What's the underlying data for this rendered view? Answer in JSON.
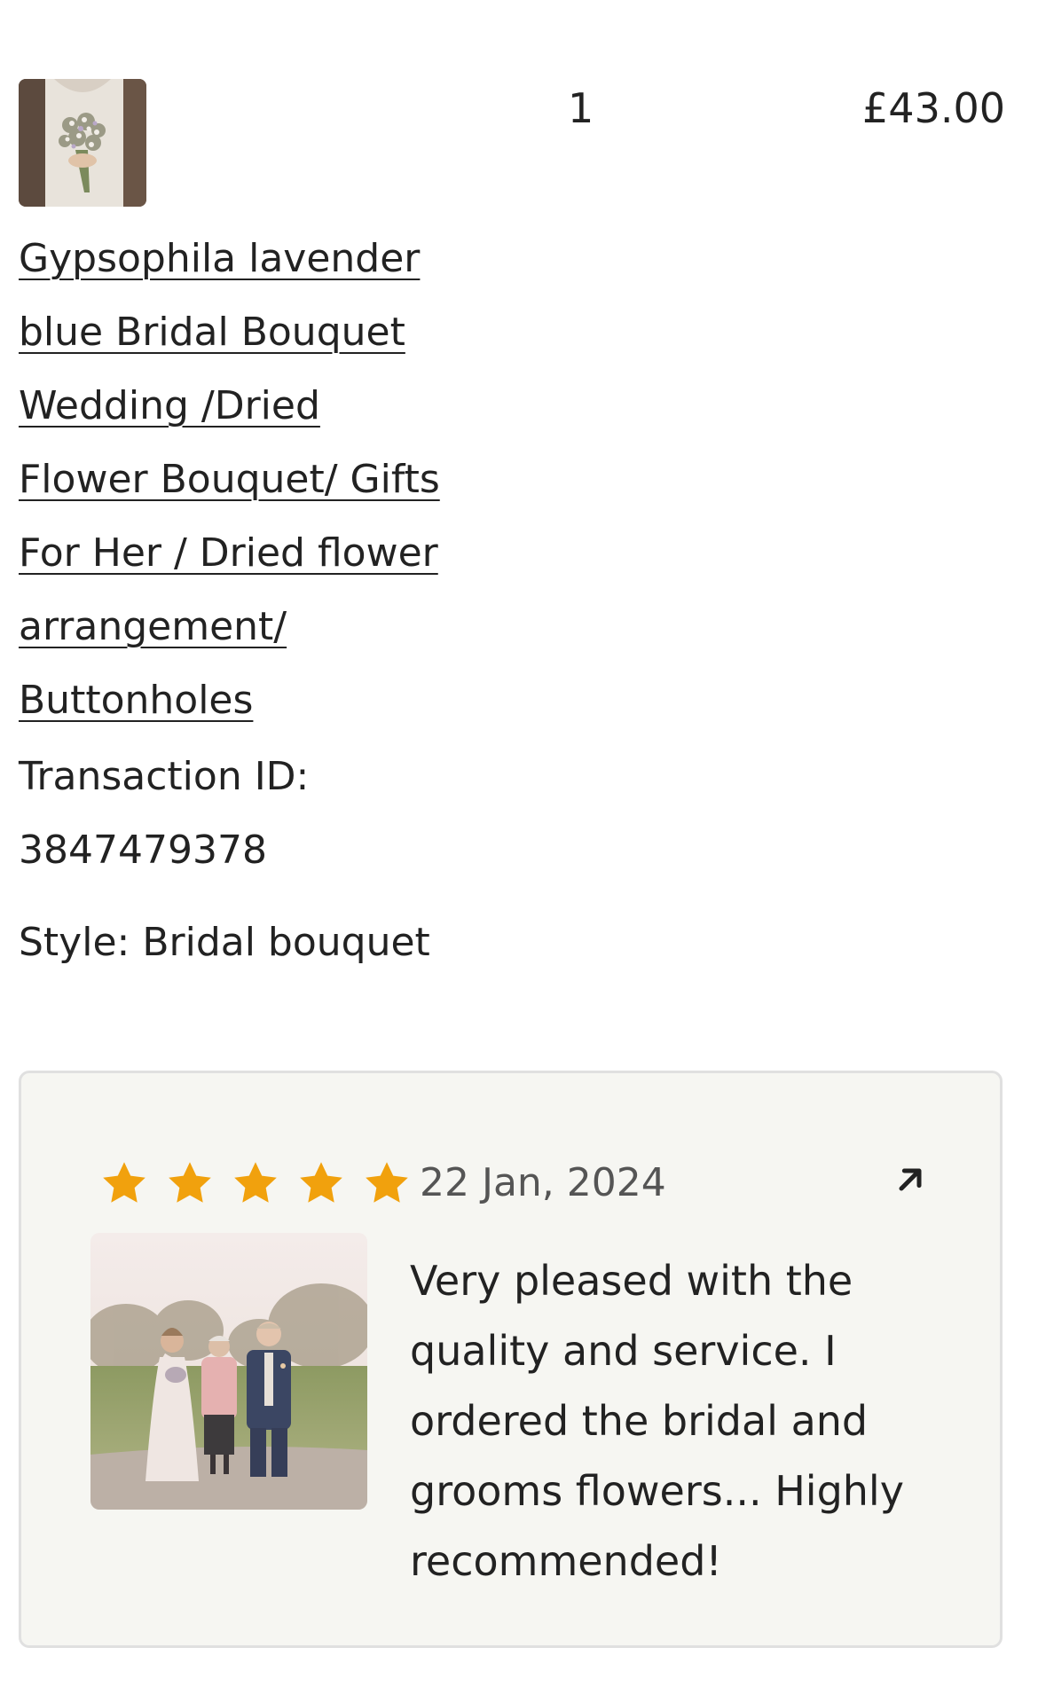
{
  "order_item": {
    "quantity": "1",
    "price": "£43.00",
    "title_lines": [
      "Gypsophila lavender",
      "blue Bridal Bouquet",
      "Wedding /Dried",
      "Flower Bouquet/ Gifts",
      "For Her / Dried flower",
      "arrangement/",
      "Buttonholes"
    ],
    "transaction_label": "Transaction ID:",
    "transaction_id": "3847479378",
    "style_line": "Style: Bridal bouquet",
    "thumbnail_icon": "bridal-bouquet-photo"
  },
  "review": {
    "rating": 5,
    "max_rating": 5,
    "star_color": "#f1a10d",
    "date": "22 Jan, 2024",
    "open_icon": "arrow-up-right-icon",
    "photo_icon": "wedding-party-photo",
    "text_lines": [
      "Very pleased with the",
      "quality and service. I",
      "ordered the bridal and",
      "grooms flowers... Highly",
      "recommended!"
    ]
  }
}
